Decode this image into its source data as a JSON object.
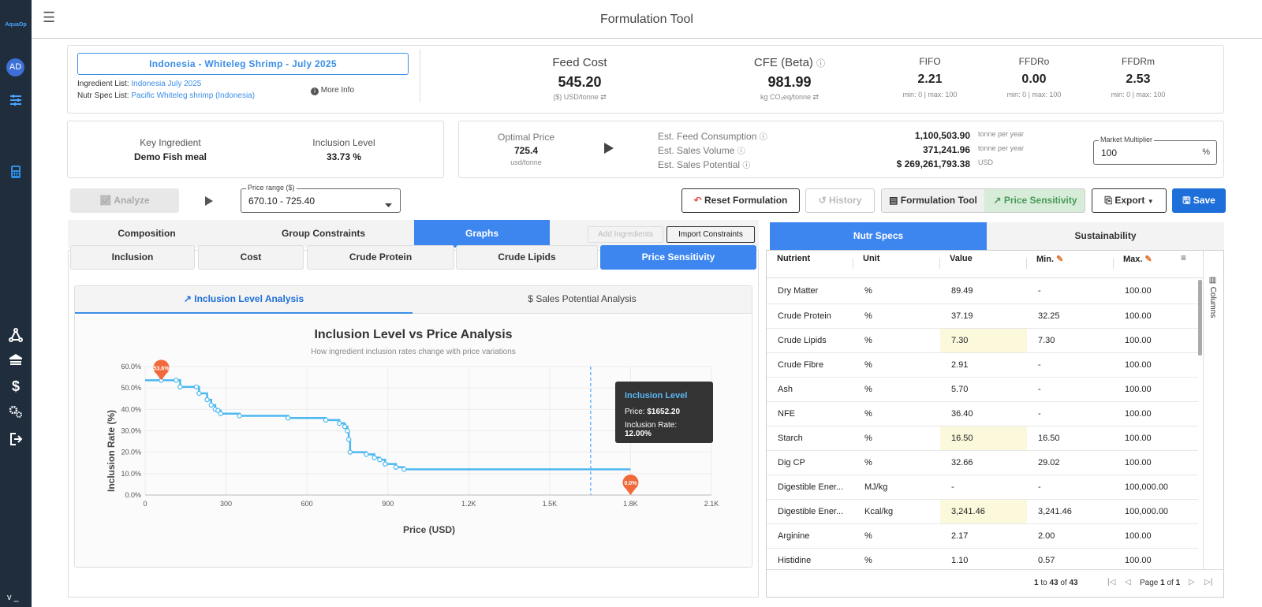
{
  "app": {
    "title": "Formulation Tool",
    "logo": "AquaOp",
    "user_initials": "AD",
    "version": "v _"
  },
  "sidebar": {
    "icons": [
      "tune-icon",
      "calculator-icon",
      "sitemap-icon",
      "warehouse-icon",
      "dollar-icon",
      "gears-icon",
      "logout-icon"
    ]
  },
  "project": {
    "name": "Indonesia - Whiteleg Shrimp - July 2025",
    "ingredient_label": "Ingredient List:",
    "ingredient_value": "Indonesia July 2025",
    "nutr_label": "Nutr Spec List:",
    "nutr_value": "Pacific Whiteleg shrimp (Indonesia)",
    "more_info": "More Info"
  },
  "metrics": {
    "feed_cost": {
      "title": "Feed Cost",
      "value": "545.20",
      "unit": "($) USD/tonne"
    },
    "cfe": {
      "title": "CFE (Beta)",
      "value": "981.99",
      "unit": "kg CO₂eq/tonne"
    },
    "fifo": {
      "title": "FIFO",
      "value": "2.21",
      "range": "min: 0 | max: 100"
    },
    "ffdro": {
      "title": "FFDRo",
      "value": "0.00",
      "range": "min: 0 | max: 100"
    },
    "ffdrm": {
      "title": "FFDRm",
      "value": "2.53",
      "range": "min: 0 | max: 100"
    }
  },
  "key_ingredient": {
    "label": "Key Ingredient",
    "value": "Demo Fish meal",
    "inclusion_label": "Inclusion Level",
    "inclusion_value": "33.73 %"
  },
  "optimal": {
    "label": "Optimal Price",
    "value": "725.4",
    "unit": "usd/tonne"
  },
  "estimates": {
    "consumption_label": "Est. Feed Consumption",
    "consumption_value": "1,100,503.90",
    "consumption_unit": "tonne per year",
    "volume_label": "Est. Sales Volume",
    "volume_value": "371,241.96",
    "volume_unit": "tonne per year",
    "potential_label": "Est. Sales Potential",
    "potential_value": "$ 269,261,793.38",
    "potential_unit": "USD"
  },
  "market": {
    "label": "Market Multiplier",
    "value": "100",
    "unit": "%"
  },
  "toolbar": {
    "analyze": "Analyze",
    "price_range_label": "Price range ($)",
    "price_range_value": "670.10 - 725.40",
    "reset": "Reset Formulation",
    "history": "History",
    "formulation_tool": "Formulation Tool",
    "price_sensitivity": "Price Sensitivity",
    "export": "Export",
    "save": "Save"
  },
  "tabs": {
    "composition": "Composition",
    "group_constraints": "Group Constraints",
    "graphs": "Graphs",
    "add_ingredients": "Add Ingredients",
    "import_constraints": "Import Constraints"
  },
  "subtabs": {
    "inclusion": "Inclusion",
    "cost": "Cost",
    "crude_protein": "Crude Protein",
    "crude_lipids": "Crude Lipids",
    "price_sensitivity": "Price Sensitivity"
  },
  "analysis_tabs": {
    "inclusion": "Inclusion Level Analysis",
    "sales": "Sales Potential Analysis"
  },
  "chart_data": {
    "type": "line",
    "title": "Inclusion Level vs Price Analysis",
    "subtitle": "How ingredient inclusion rates change with price variations",
    "xlabel": "Price (USD)",
    "ylabel": "Inclusion Rate (%)",
    "xlim": [
      0,
      2100
    ],
    "ylim": [
      0,
      60
    ],
    "x_ticks": [
      "0",
      "300",
      "600",
      "900",
      "1.2K",
      "1.5K",
      "1.8K",
      "2.1K"
    ],
    "y_ticks": [
      "0.0%",
      "10.0%",
      "20.0%",
      "30.0%",
      "40.0%",
      "50.0%",
      "60.0%"
    ],
    "x": [
      0,
      60,
      115,
      130,
      190,
      200,
      230,
      245,
      260,
      270,
      280,
      350,
      530,
      670,
      720,
      740,
      750,
      755,
      760,
      820,
      850,
      870,
      890,
      930,
      960,
      1800
    ],
    "y": [
      53.6,
      53.6,
      53.6,
      50.5,
      50.5,
      47.5,
      44.5,
      42,
      40,
      39.5,
      38,
      37,
      36,
      35,
      33.5,
      32,
      30,
      26,
      20,
      19,
      17.5,
      16.5,
      14.5,
      13,
      12,
      12
    ],
    "max_label": "53.6%",
    "min_label": "0.0%",
    "min_x": 1800,
    "cursor_x": 1652.2,
    "tooltip": {
      "title": "Inclusion Level",
      "price_label": "Price:",
      "price": "$1652.20",
      "rate_label": "Inclusion Rate:",
      "rate": "12.00%"
    },
    "grid": true
  },
  "nutr": {
    "tab_specs": "Nutr Specs",
    "tab_sust": "Sustainability",
    "columns_label": "Columns",
    "headers": {
      "nutrient": "Nutrient",
      "unit": "Unit",
      "value": "Value",
      "min": "Min.",
      "max": "Max."
    },
    "rows": [
      {
        "n": "Dry Matter",
        "u": "%",
        "v": "89.49",
        "min": "-",
        "max": "100.00",
        "hl": false
      },
      {
        "n": "Crude Protein",
        "u": "%",
        "v": "37.19",
        "min": "32.25",
        "max": "100.00",
        "hl": false
      },
      {
        "n": "Crude Lipids",
        "u": "%",
        "v": "7.30",
        "min": "7.30",
        "max": "100.00",
        "hl": true
      },
      {
        "n": "Crude Fibre",
        "u": "%",
        "v": "2.91",
        "min": "-",
        "max": "100.00",
        "hl": false
      },
      {
        "n": "Ash",
        "u": "%",
        "v": "5.70",
        "min": "-",
        "max": "100.00",
        "hl": false
      },
      {
        "n": "NFE",
        "u": "%",
        "v": "36.40",
        "min": "-",
        "max": "100.00",
        "hl": false
      },
      {
        "n": "Starch",
        "u": "%",
        "v": "16.50",
        "min": "16.50",
        "max": "100.00",
        "hl": true
      },
      {
        "n": "Dig CP",
        "u": "%",
        "v": "32.66",
        "min": "29.02",
        "max": "100.00",
        "hl": false
      },
      {
        "n": "Digestible Ener...",
        "u": "MJ/kg",
        "v": "-",
        "min": "-",
        "max": "100,000.00",
        "hl": false
      },
      {
        "n": "Digestible Ener...",
        "u": "Kcal/kg",
        "v": "3,241.46",
        "min": "3,241.46",
        "max": "100,000.00",
        "hl": true
      },
      {
        "n": "Arginine",
        "u": "%",
        "v": "2.17",
        "min": "2.00",
        "max": "100.00",
        "hl": false
      },
      {
        "n": "Histidine",
        "u": "%",
        "v": "1.10",
        "min": "0.57",
        "max": "100.00",
        "hl": false
      }
    ],
    "pager": {
      "from": "1",
      "to_label": "to",
      "to": "43",
      "of_label": "of",
      "total": "43",
      "page_label": "Page",
      "page": "1",
      "page_of": "of",
      "pages": "1"
    }
  }
}
